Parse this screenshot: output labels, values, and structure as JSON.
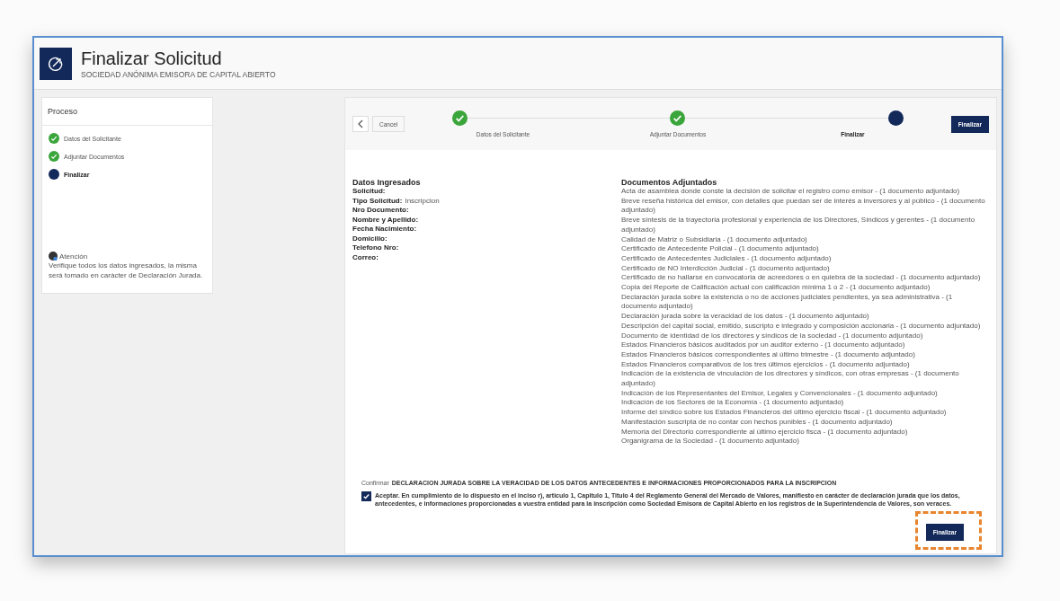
{
  "header": {
    "title": "Finalizar Solicitud",
    "subtitle": "SOCIEDAD ANÓNIMA EMISORA DE CAPITAL ABIERTO"
  },
  "sidebar": {
    "title": "Proceso",
    "steps": [
      {
        "label": "Datos del Solicitante",
        "done": true,
        "selected": false
      },
      {
        "label": "Adjuntar Documentos",
        "done": true,
        "selected": false
      },
      {
        "label": "Finalizar",
        "done": false,
        "selected": true
      }
    ],
    "notice": {
      "title": "Atención",
      "text": "Verifique todos los datos ingresados, la misma será tomado en carácter de Declaración Jurada."
    }
  },
  "wizard": {
    "cancel": "Cancel",
    "finish": "Finalizar",
    "steps": [
      {
        "label": "Datos del Solicitante",
        "done": true,
        "selected": false
      },
      {
        "label": "Adjuntar Documentos",
        "done": true,
        "selected": false
      },
      {
        "label": "Finalizar",
        "done": false,
        "selected": true
      }
    ]
  },
  "datos": {
    "title": "Datos Ingresados",
    "fields": [
      {
        "label": "Solicitud:"
      },
      {
        "label": "Tipo Solicitud:",
        "value": "Inscripcion"
      },
      {
        "label": "Nro Documento:"
      },
      {
        "label": "Nombre y Apellido:"
      },
      {
        "label": "Fecha Nacimiento:"
      },
      {
        "label": "Domicilio:"
      },
      {
        "label": "Telefono Nro:"
      },
      {
        "label": "Correo:"
      }
    ]
  },
  "documentos": {
    "title": "Documentos Adjuntados",
    "items": [
      "Acta de asamblea donde conste la decisión de solicitar el registro como emisor - (1 documento adjuntado)",
      "Breve reseña histórica del emisor, con detalles que puedan ser de interés a inversores y al público - (1 documento adjuntado)",
      "Breve síntesis de la trayectoria profesional y experiencia de los Directores, Síndicos y gerentes - (1 documento adjuntado)",
      "Calidad de Matriz o Subsidiaria - (1 documento adjuntado)",
      "Certificado de Antecedente Policial - (1 documento adjuntado)",
      "Certificado de Antecedentes Judiciales - (1 documento adjuntado)",
      "Certificado de NO Interdicción Judicial - (1 documento adjuntado)",
      "Certificado de no hallarse en convocatoria de acreedores o en quiebra de la sociedad - (1 documento adjuntado)",
      "Copia del Reporte de Calificación actual con calificación mínima 1 o 2 - (1 documento adjuntado)",
      "Declaración jurada sobre la existencia o no de acciones judiciales pendientes, ya sea administrativa - (1 documento adjuntado)",
      "Declaración jurada sobre la veracidad de los datos - (1 documento adjuntado)",
      "Descripción del capital social, emitido, suscripto e integrado y composición accionaria - (1 documento adjuntado)",
      "Documento de identidad de los directores y síndicos de la sociedad - (1 documento adjuntado)",
      "Estados Financieros básicos auditados por un auditor externo - (1 documento adjuntado)",
      "Estados Financieros básicos correspondientes al último trimestre - (1 documento adjuntado)",
      "Estados Financieros comparativos de los tres últimos ejercicios - (1 documento adjuntado)",
      "Indicación de la existencia de vinculación de los directores y síndicos, con otras empresas - (1 documento adjuntado)",
      "Indicación de los Representantes del Emisor, Legales y Convencionales - (1 documento adjuntado)",
      "Indicación de los Sectores de la Economía - (1 documento adjuntado)",
      "Informe del síndico sobre los Estados Financieros del último ejercicio fiscal - (1 documento adjuntado)",
      "Manifestación suscripta de no contar con hechos punibles - (1 documento adjuntado)",
      "Memoria del Directorio correspondiente al último ejercicio fisca - (1 documento adjuntado)",
      "Organigrama de la Sociedad - (1 documento adjuntado)"
    ]
  },
  "confirm": {
    "prefix": "Confirmar",
    "heading": "DECLARACION JURADA SOBRE LA VERACIDAD DE LOS DATOS ANTECEDENTES E INFORMACIONES PROPORCIONADOS PARA LA INSCRIPCION",
    "checked": true,
    "text": "Aceptar. En cumplimiento de lo dispuesto en el inciso r), articulo 1, Capitulo 1, Titulo 4 del Reglamento General del Mercado de Valores, manifiesto en carácter de declaración jurada que los datos, antecedentes, e informaciones proporcionadas a vuestra entidad para la inscripción como Sociedad Emisora de Capital Abierto en los registros de la Superintendencia de Valores, son veraces.",
    "finish": "Finalizar",
    "highlighted": true
  }
}
